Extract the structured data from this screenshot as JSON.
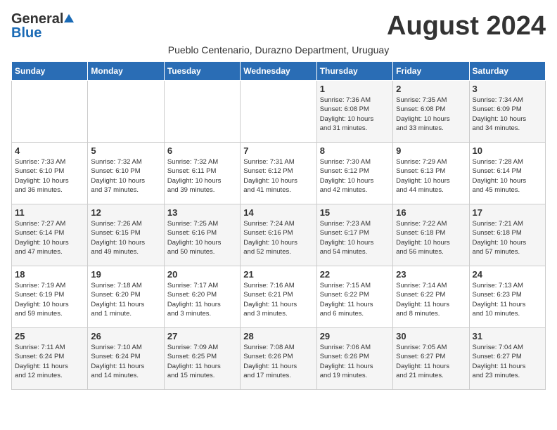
{
  "header": {
    "logo_general": "General",
    "logo_blue": "Blue",
    "month_title": "August 2024",
    "subtitle": "Pueblo Centenario, Durazno Department, Uruguay"
  },
  "days_of_week": [
    "Sunday",
    "Monday",
    "Tuesday",
    "Wednesday",
    "Thursday",
    "Friday",
    "Saturday"
  ],
  "weeks": [
    [
      {
        "day": "",
        "info": ""
      },
      {
        "day": "",
        "info": ""
      },
      {
        "day": "",
        "info": ""
      },
      {
        "day": "",
        "info": ""
      },
      {
        "day": "1",
        "info": "Sunrise: 7:36 AM\nSunset: 6:08 PM\nDaylight: 10 hours\nand 31 minutes."
      },
      {
        "day": "2",
        "info": "Sunrise: 7:35 AM\nSunset: 6:08 PM\nDaylight: 10 hours\nand 33 minutes."
      },
      {
        "day": "3",
        "info": "Sunrise: 7:34 AM\nSunset: 6:09 PM\nDaylight: 10 hours\nand 34 minutes."
      }
    ],
    [
      {
        "day": "4",
        "info": "Sunrise: 7:33 AM\nSunset: 6:10 PM\nDaylight: 10 hours\nand 36 minutes."
      },
      {
        "day": "5",
        "info": "Sunrise: 7:32 AM\nSunset: 6:10 PM\nDaylight: 10 hours\nand 37 minutes."
      },
      {
        "day": "6",
        "info": "Sunrise: 7:32 AM\nSunset: 6:11 PM\nDaylight: 10 hours\nand 39 minutes."
      },
      {
        "day": "7",
        "info": "Sunrise: 7:31 AM\nSunset: 6:12 PM\nDaylight: 10 hours\nand 41 minutes."
      },
      {
        "day": "8",
        "info": "Sunrise: 7:30 AM\nSunset: 6:12 PM\nDaylight: 10 hours\nand 42 minutes."
      },
      {
        "day": "9",
        "info": "Sunrise: 7:29 AM\nSunset: 6:13 PM\nDaylight: 10 hours\nand 44 minutes."
      },
      {
        "day": "10",
        "info": "Sunrise: 7:28 AM\nSunset: 6:14 PM\nDaylight: 10 hours\nand 45 minutes."
      }
    ],
    [
      {
        "day": "11",
        "info": "Sunrise: 7:27 AM\nSunset: 6:14 PM\nDaylight: 10 hours\nand 47 minutes."
      },
      {
        "day": "12",
        "info": "Sunrise: 7:26 AM\nSunset: 6:15 PM\nDaylight: 10 hours\nand 49 minutes."
      },
      {
        "day": "13",
        "info": "Sunrise: 7:25 AM\nSunset: 6:16 PM\nDaylight: 10 hours\nand 50 minutes."
      },
      {
        "day": "14",
        "info": "Sunrise: 7:24 AM\nSunset: 6:16 PM\nDaylight: 10 hours\nand 52 minutes."
      },
      {
        "day": "15",
        "info": "Sunrise: 7:23 AM\nSunset: 6:17 PM\nDaylight: 10 hours\nand 54 minutes."
      },
      {
        "day": "16",
        "info": "Sunrise: 7:22 AM\nSunset: 6:18 PM\nDaylight: 10 hours\nand 56 minutes."
      },
      {
        "day": "17",
        "info": "Sunrise: 7:21 AM\nSunset: 6:18 PM\nDaylight: 10 hours\nand 57 minutes."
      }
    ],
    [
      {
        "day": "18",
        "info": "Sunrise: 7:19 AM\nSunset: 6:19 PM\nDaylight: 10 hours\nand 59 minutes."
      },
      {
        "day": "19",
        "info": "Sunrise: 7:18 AM\nSunset: 6:20 PM\nDaylight: 11 hours\nand 1 minute."
      },
      {
        "day": "20",
        "info": "Sunrise: 7:17 AM\nSunset: 6:20 PM\nDaylight: 11 hours\nand 3 minutes."
      },
      {
        "day": "21",
        "info": "Sunrise: 7:16 AM\nSunset: 6:21 PM\nDaylight: 11 hours\nand 3 minutes."
      },
      {
        "day": "22",
        "info": "Sunrise: 7:15 AM\nSunset: 6:22 PM\nDaylight: 11 hours\nand 6 minutes."
      },
      {
        "day": "23",
        "info": "Sunrise: 7:14 AM\nSunset: 6:22 PM\nDaylight: 11 hours\nand 8 minutes."
      },
      {
        "day": "24",
        "info": "Sunrise: 7:13 AM\nSunset: 6:23 PM\nDaylight: 11 hours\nand 10 minutes."
      }
    ],
    [
      {
        "day": "25",
        "info": "Sunrise: 7:11 AM\nSunset: 6:24 PM\nDaylight: 11 hours\nand 12 minutes."
      },
      {
        "day": "26",
        "info": "Sunrise: 7:10 AM\nSunset: 6:24 PM\nDaylight: 11 hours\nand 14 minutes."
      },
      {
        "day": "27",
        "info": "Sunrise: 7:09 AM\nSunset: 6:25 PM\nDaylight: 11 hours\nand 15 minutes."
      },
      {
        "day": "28",
        "info": "Sunrise: 7:08 AM\nSunset: 6:26 PM\nDaylight: 11 hours\nand 17 minutes."
      },
      {
        "day": "29",
        "info": "Sunrise: 7:06 AM\nSunset: 6:26 PM\nDaylight: 11 hours\nand 19 minutes."
      },
      {
        "day": "30",
        "info": "Sunrise: 7:05 AM\nSunset: 6:27 PM\nDaylight: 11 hours\nand 21 minutes."
      },
      {
        "day": "31",
        "info": "Sunrise: 7:04 AM\nSunset: 6:27 PM\nDaylight: 11 hours\nand 23 minutes."
      }
    ]
  ]
}
